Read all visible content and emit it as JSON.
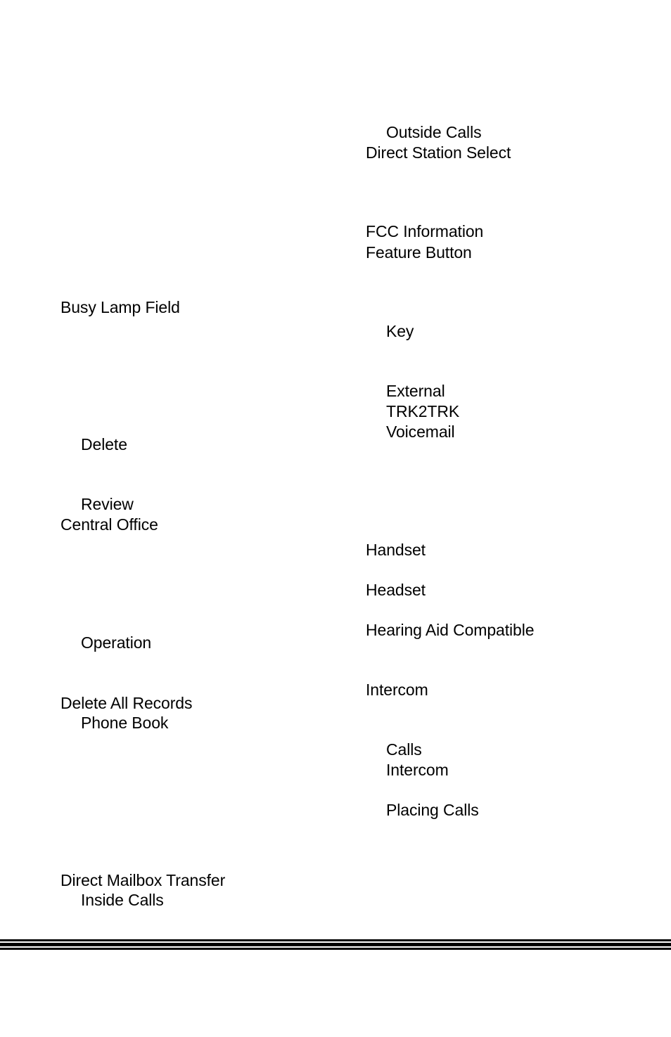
{
  "index": {
    "left_column": [
      {
        "text": "Busy Lamp Field",
        "level": "main"
      },
      {
        "text": "Delete",
        "level": "sub"
      },
      {
        "text": "Review",
        "level": "sub"
      },
      {
        "text": "Central Office",
        "level": "main"
      },
      {
        "text": "Operation",
        "level": "sub"
      },
      {
        "text": "Delete All Records",
        "level": "main"
      },
      {
        "text": "Phone Book",
        "level": "sub"
      },
      {
        "text": "Direct Mailbox Transfer",
        "level": "main"
      },
      {
        "text": "Inside Calls",
        "level": "sub"
      }
    ],
    "right_column": [
      {
        "text": "Outside Calls",
        "level": "sub"
      },
      {
        "text": "Direct Station Select",
        "level": "main"
      },
      {
        "text": "FCC Information",
        "level": "main"
      },
      {
        "text": "Feature Button",
        "level": "main"
      },
      {
        "text": "Key",
        "level": "sub"
      },
      {
        "text": "External",
        "level": "sub"
      },
      {
        "text": "TRK2TRK",
        "level": "sub"
      },
      {
        "text": "Voicemail",
        "level": "sub"
      },
      {
        "text": "Handset",
        "level": "main"
      },
      {
        "text": "Headset",
        "level": "main"
      },
      {
        "text": "Hearing Aid Compatible",
        "level": "main"
      },
      {
        "text": "Intercom",
        "level": "main"
      },
      {
        "text": "Calls",
        "level": "sub"
      },
      {
        "text": "Intercom",
        "level": "sub"
      },
      {
        "text": "Placing Calls",
        "level": "sub"
      }
    ]
  },
  "colors": {
    "text": "#000000",
    "background": "#ffffff",
    "footer_rule": "#000000"
  }
}
